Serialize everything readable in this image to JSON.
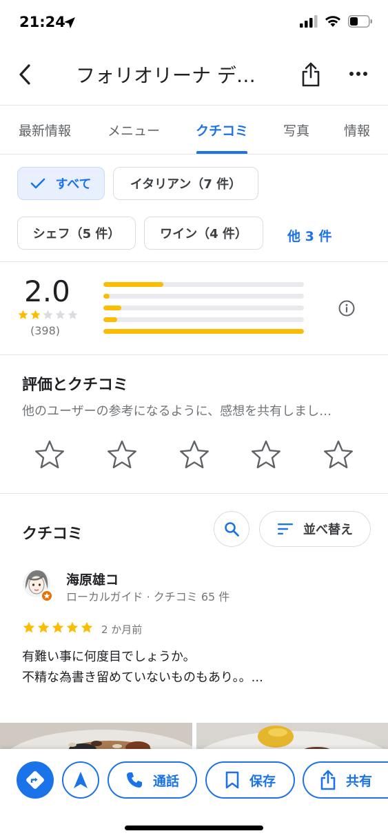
{
  "status_bar": {
    "time": "21:24"
  },
  "header": {
    "title": "フォリオリーナ デ…"
  },
  "tabs": [
    {
      "label": "最新情報"
    },
    {
      "label": "メニュー"
    },
    {
      "label": "クチコミ"
    },
    {
      "label": "写真"
    },
    {
      "label": "情報"
    }
  ],
  "active_tab": "クチコミ",
  "filters": {
    "chips": [
      {
        "label": "すべて",
        "selected": true
      },
      {
        "label": "イタリアン（7 件）",
        "selected": false
      },
      {
        "label": "シェフ（5 件）",
        "selected": false
      },
      {
        "label": "ワイン（4 件）",
        "selected": false
      }
    ],
    "more": "他 3 件"
  },
  "rating_summary": {
    "value": "2.0",
    "stars": 2,
    "count": "(398)",
    "distribution": [
      {
        "stars": 5,
        "fraction": 0.3
      },
      {
        "stars": 4,
        "fraction": 0.03
      },
      {
        "stars": 3,
        "fraction": 0.09
      },
      {
        "stars": 2,
        "fraction": 0.07
      },
      {
        "stars": 1,
        "fraction": 1.0
      }
    ]
  },
  "rate_section": {
    "title": "評価とクチコミ",
    "subtitle": "他のユーザーの参考になるように、感想を共有しまし…"
  },
  "reviews_section": {
    "title": "クチコミ",
    "sort_label": "並べ替え"
  },
  "review": {
    "author": "海原雄コ",
    "meta": "ローカルガイド · クチコミ 65 件",
    "stars": 5,
    "date": "2 か月前",
    "text_line1": "有難い事に何度目でしょうか。",
    "text_line2": "不精な為書き留めていないものもあり。。..."
  },
  "actions": {
    "call": "通話",
    "save": "保存",
    "share": "共有"
  },
  "colors": {
    "accent": "#1a73e8",
    "star": "#fbbc04",
    "text_secondary": "#70757a"
  }
}
